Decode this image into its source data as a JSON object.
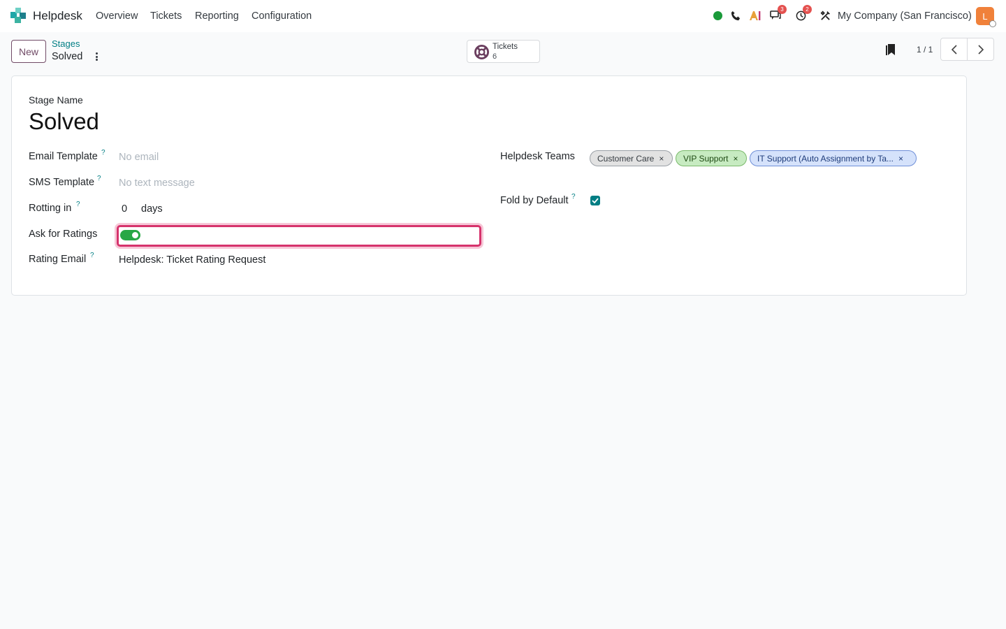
{
  "navbar": {
    "app_name": "Helpdesk",
    "menu": [
      "Overview",
      "Tickets",
      "Reporting",
      "Configuration"
    ],
    "chat_badge": "3",
    "activity_badge": "2",
    "company": "My Company (San Francisco)",
    "avatar_initial": "L",
    "colors": {
      "presence": "#1a9a3a",
      "avatar": "#f0813a"
    }
  },
  "control_panel": {
    "new_label": "New",
    "breadcrumb_parent": "Stages",
    "breadcrumb_current": "Solved",
    "smart_button": {
      "label": "Tickets",
      "count": "6",
      "icon": "life-ring-icon"
    },
    "pager": "1 / 1"
  },
  "form": {
    "stage_name_label": "Stage Name",
    "stage_name": "Solved",
    "email_template": {
      "label": "Email Template",
      "help": "?",
      "placeholder": "No email"
    },
    "sms_template": {
      "label": "SMS Template",
      "help": "?",
      "placeholder": "No text message"
    },
    "rotting": {
      "label": "Rotting in",
      "help": "?",
      "value": "0",
      "unit": "days"
    },
    "ask_ratings": {
      "label": "Ask for Ratings",
      "enabled": true
    },
    "rating_email": {
      "label": "Rating Email",
      "help": "?",
      "value": "Helpdesk: Ticket Rating Request"
    },
    "helpdesk_teams": {
      "label": "Helpdesk Teams",
      "tags": [
        "Customer Care",
        "VIP Support",
        "IT Support (Auto Assignment by Ta..."
      ],
      "tag_remove": "×"
    },
    "fold_by_default": {
      "label": "Fold by Default",
      "help": "?",
      "checked": true
    },
    "colors": {
      "accent": "#017e84",
      "focus": "#d6336c",
      "toggle_on": "#28a745"
    }
  }
}
